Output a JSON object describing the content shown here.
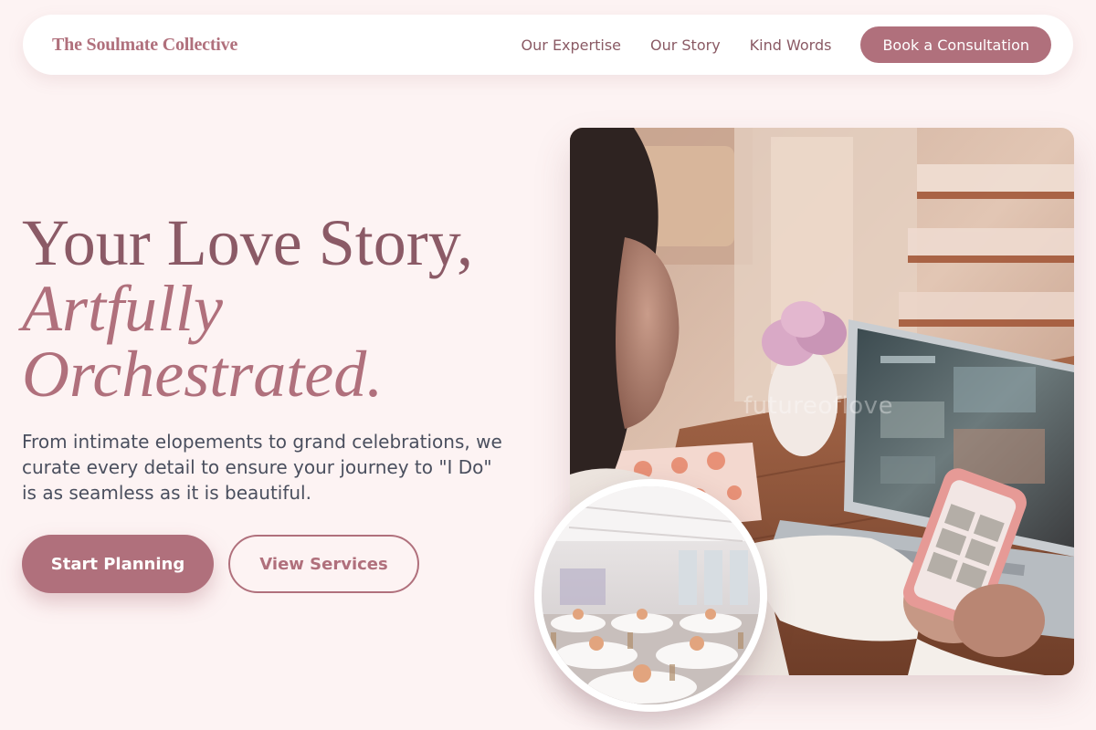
{
  "brand": {
    "name": "The Soulmate Collective"
  },
  "nav": {
    "links": [
      "Our Expertise",
      "Our Story",
      "Kind Words"
    ],
    "cta_label": "Book a Consultation"
  },
  "hero": {
    "title_line1": "Your Love Story,",
    "title_line2": "Artfully",
    "title_line3": "Orchestrated.",
    "description": "From intimate elopements to grand celebrations, we curate every detail to ensure your journey to \"I Do\" is as seamless as it is beautiful.",
    "primary_button": "Start Planning",
    "secondary_button": "View Services",
    "image_watermark": "futureoflove"
  },
  "colors": {
    "background": "#fdf3f3",
    "accent": "#b0707c",
    "heading": "#8b5a66",
    "body_text": "#4a4f5e",
    "nav_text": "#8a5a64"
  }
}
